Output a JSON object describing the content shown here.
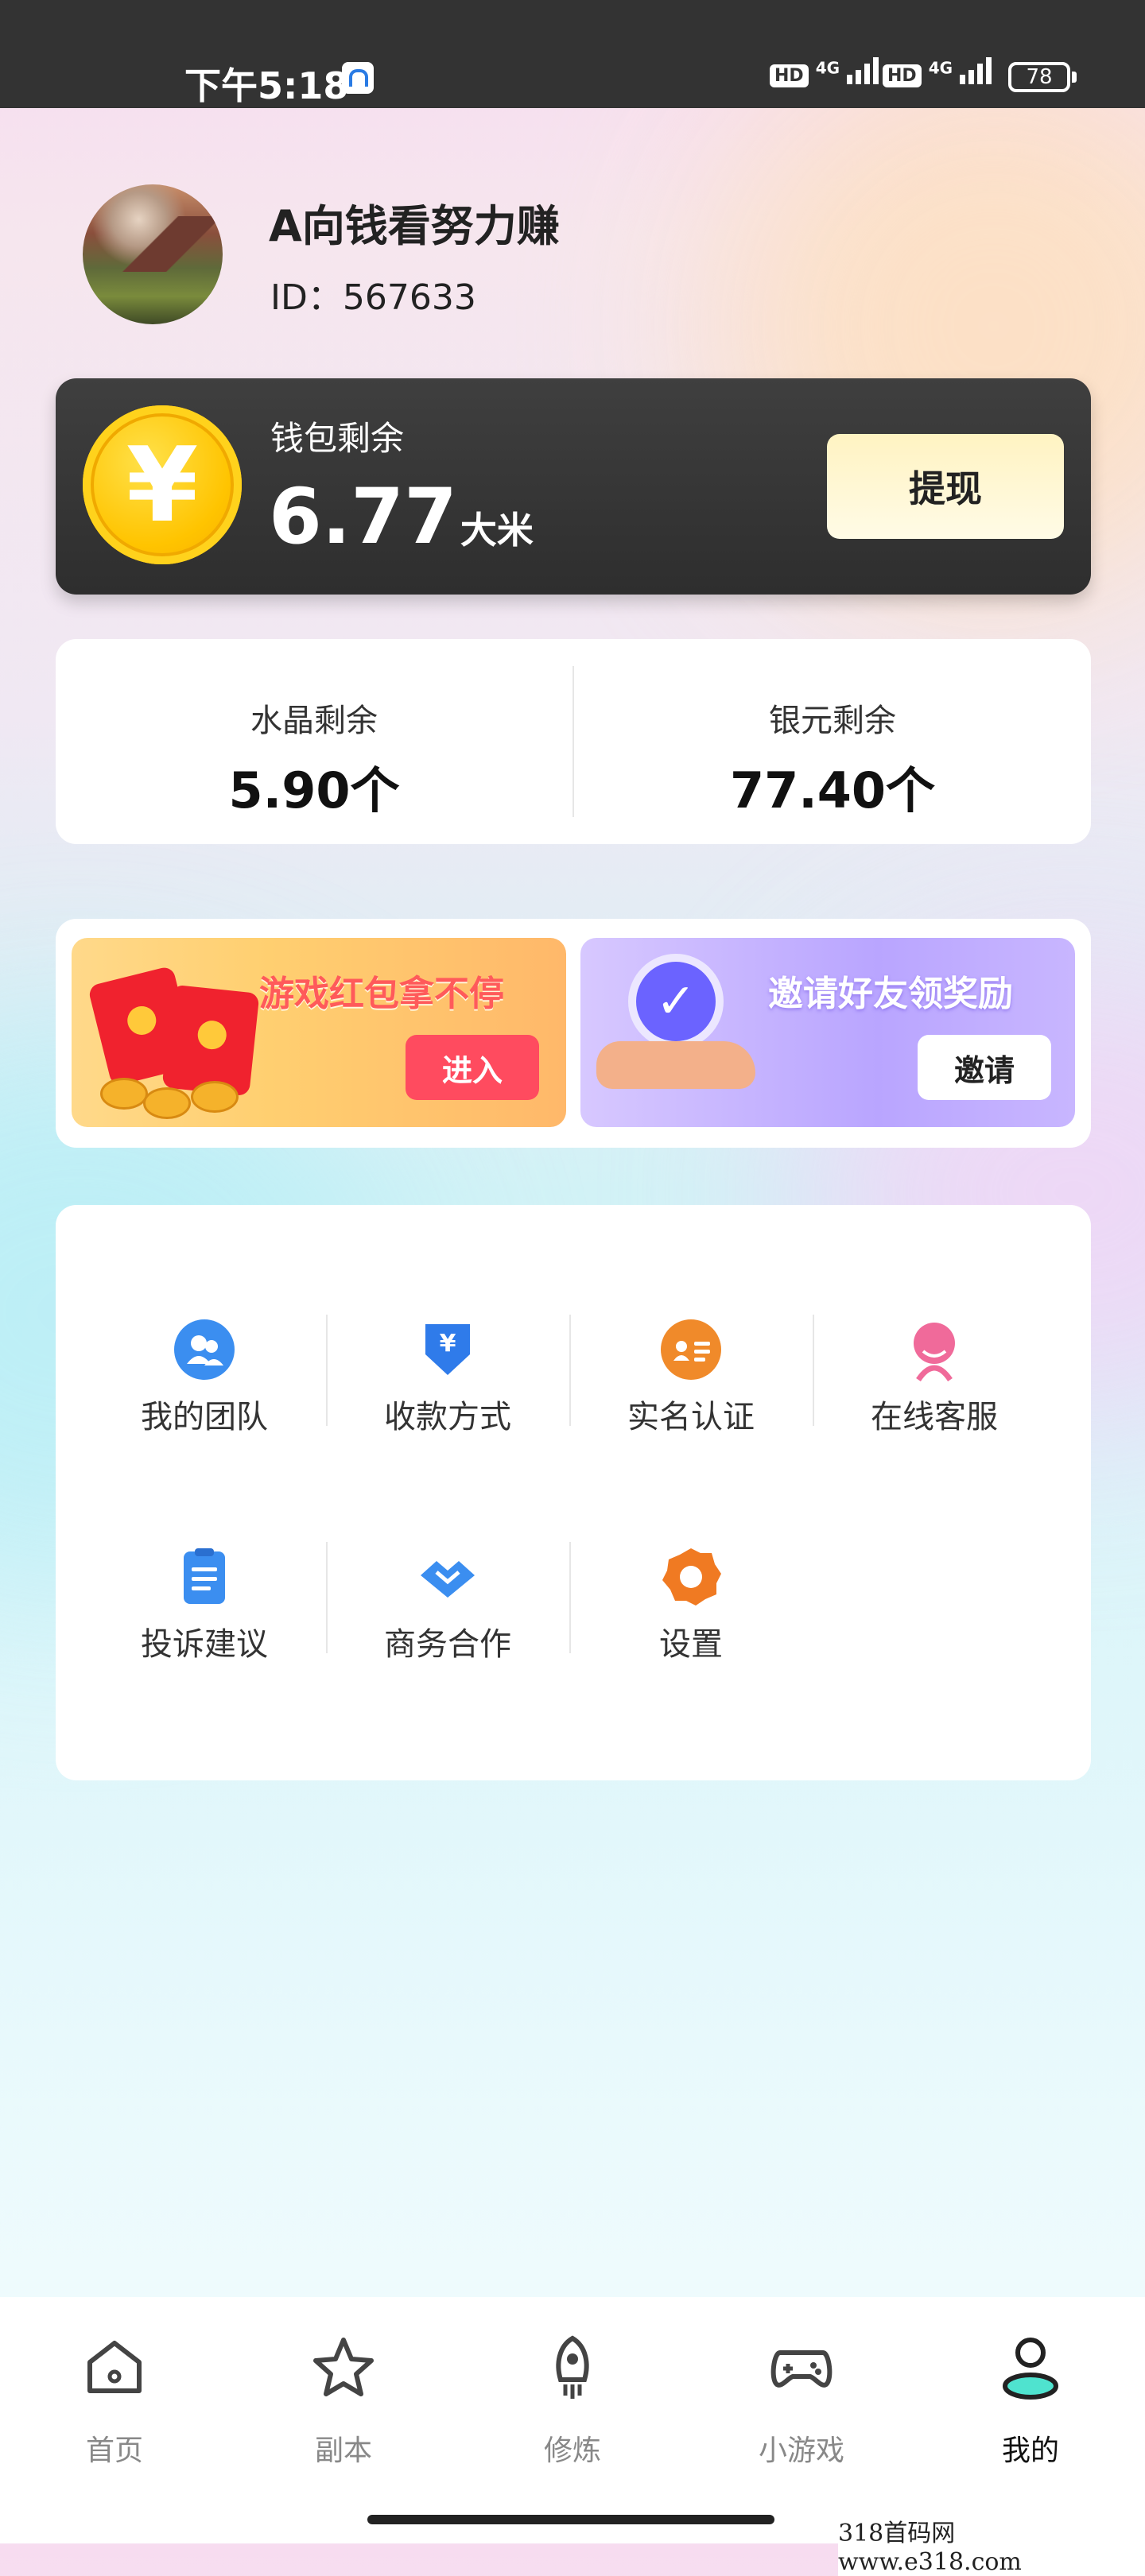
{
  "status_bar": {
    "time": "下午5:18",
    "network1": "4G",
    "network2": "4G",
    "hd1": "HD",
    "hd2": "HD",
    "battery": "78"
  },
  "profile": {
    "name": "A向钱看努力赚",
    "id_text": "ID：567633"
  },
  "wallet": {
    "label": "钱包剩余",
    "amount": "6.77",
    "unit": "大米",
    "currency_symbol": "¥",
    "withdraw_label": "提现"
  },
  "balances": [
    {
      "title": "水晶剩余",
      "value": "5.90个"
    },
    {
      "title": "银元剩余",
      "value": "77.40个"
    }
  ],
  "banners": {
    "left": {
      "title": "游戏红包拿不停",
      "button": "进入"
    },
    "right": {
      "title": "邀请好友领奖励",
      "button": "邀请"
    }
  },
  "menu": [
    {
      "label": "我的团队",
      "icon": "team-icon",
      "color": "#3b8ef0"
    },
    {
      "label": "收款方式",
      "icon": "payment-icon",
      "color": "#2f7bea"
    },
    {
      "label": "实名认证",
      "icon": "id-card-icon",
      "color": "#f08a2a"
    },
    {
      "label": "在线客服",
      "icon": "customer-service-icon",
      "color": "#f06a9a"
    },
    {
      "label": "投诉建议",
      "icon": "clipboard-icon",
      "color": "#3b8ef0"
    },
    {
      "label": "商务合作",
      "icon": "handshake-icon",
      "color": "#3b8ef0"
    },
    {
      "label": "设置",
      "icon": "gear-icon",
      "color": "#f07a22"
    }
  ],
  "bottom_nav": [
    {
      "label": "首页",
      "icon": "home-icon"
    },
    {
      "label": "副本",
      "icon": "star-icon"
    },
    {
      "label": "修炼",
      "icon": "rocket-icon"
    },
    {
      "label": "小游戏",
      "icon": "gamepad-icon"
    },
    {
      "label": "我的",
      "icon": "profile-icon",
      "active": true
    }
  ],
  "watermark": "318首码网  www.e318.com"
}
